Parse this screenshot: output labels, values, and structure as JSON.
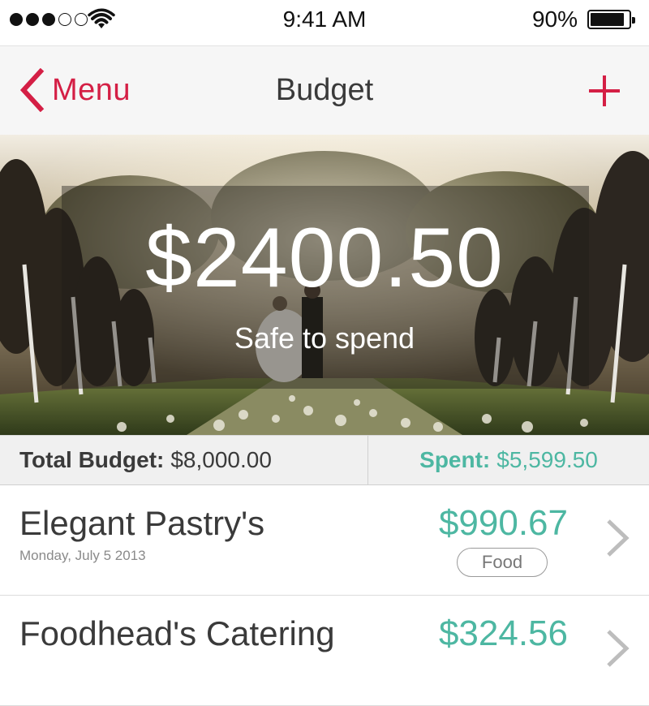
{
  "status_bar": {
    "time": "9:41 AM",
    "battery_percent": "90%",
    "signal_bars": 3,
    "signal_total": 5,
    "battery_level": 0.9
  },
  "nav": {
    "back_label": "Menu",
    "title": "Budget",
    "icons": {
      "back": "chevron-left-icon",
      "add": "plus-icon"
    }
  },
  "hero": {
    "amount": "$2400.50",
    "label": "Safe to spend"
  },
  "summary": {
    "total_label": "Total Budget:",
    "total_value": "$8,000.00",
    "spent_label": "Spent:",
    "spent_value": "$5,599.50"
  },
  "expenses": [
    {
      "name": "Elegant Pastry's",
      "date": "Monday, July 5 2013",
      "amount": "$990.67",
      "category": "Food"
    },
    {
      "name": "Foodhead's Catering",
      "date": "",
      "amount": "$324.56",
      "category": ""
    }
  ],
  "colors": {
    "accent": "#d41f45",
    "money": "#4db7a2",
    "nav_background": "#f6f6f6",
    "summary_background": "#f0f0f0"
  }
}
